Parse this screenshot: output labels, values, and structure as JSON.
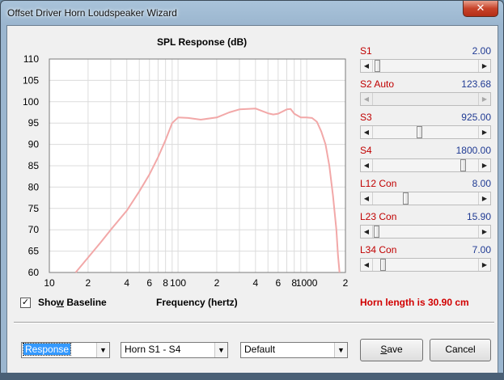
{
  "window": {
    "title": "Offset Driver Horn Loudspeaker Wizard",
    "close_label": "✕"
  },
  "chart": {
    "title": "SPL Response (dB)",
    "xlabel": "Frequency (hertz)"
  },
  "chart_data": {
    "type": "line",
    "title": "SPL Response (dB)",
    "xlabel": "Frequency (hertz)",
    "ylabel": "",
    "xscale": "log",
    "xlim": [
      10,
      2000
    ],
    "ylim": [
      60,
      110
    ],
    "grid": true,
    "y_ticks": [
      60,
      65,
      70,
      75,
      80,
      85,
      90,
      95,
      100,
      105,
      110
    ],
    "x_ticks": [
      {
        "v": 10,
        "label": "10"
      },
      {
        "v": 20,
        "label": "2"
      },
      {
        "v": 40,
        "label": "4"
      },
      {
        "v": 60,
        "label": "6"
      },
      {
        "v": 80,
        "label": "8"
      },
      {
        "v": 100,
        "label": "100"
      },
      {
        "v": 200,
        "label": "2"
      },
      {
        "v": 400,
        "label": "4"
      },
      {
        "v": 600,
        "label": "6"
      },
      {
        "v": 800,
        "label": "8"
      },
      {
        "v": 1000,
        "label": "1000"
      },
      {
        "v": 2000,
        "label": "2"
      }
    ],
    "series": [
      {
        "color": "#f2a8a8",
        "points": [
          [
            16,
            60
          ],
          [
            20,
            63.5
          ],
          [
            25,
            67
          ],
          [
            30,
            70
          ],
          [
            40,
            74.5
          ],
          [
            50,
            79
          ],
          [
            60,
            83
          ],
          [
            70,
            87
          ],
          [
            80,
            91
          ],
          [
            90,
            95
          ],
          [
            100,
            96.3
          ],
          [
            120,
            96.2
          ],
          [
            150,
            95.8
          ],
          [
            200,
            96.3
          ],
          [
            250,
            97.5
          ],
          [
            300,
            98.2
          ],
          [
            400,
            98.4
          ],
          [
            500,
            97.3
          ],
          [
            550,
            97
          ],
          [
            600,
            97.2
          ],
          [
            700,
            98.2
          ],
          [
            750,
            98.3
          ],
          [
            800,
            97.2
          ],
          [
            900,
            96.3
          ],
          [
            1000,
            96.3
          ],
          [
            1100,
            96.2
          ],
          [
            1200,
            95.3
          ],
          [
            1300,
            93
          ],
          [
            1400,
            90
          ],
          [
            1500,
            85
          ],
          [
            1600,
            78
          ],
          [
            1700,
            70
          ],
          [
            1750,
            64
          ],
          [
            1800,
            60
          ]
        ]
      }
    ]
  },
  "baseline": {
    "checked_glyph": "✓",
    "label_prefix": "Sho",
    "label_accel": "w",
    "label_suffix": " Baseline"
  },
  "horn_length": "Horn length is 30.90 cm",
  "params": [
    {
      "label": "S1",
      "value": "2.00",
      "thumb": 0.02,
      "disabled": false
    },
    {
      "label": "S2  Auto",
      "value": "123.68",
      "thumb": null,
      "disabled": true
    },
    {
      "label": "S3",
      "value": "925.00",
      "thumb": 0.44,
      "disabled": false
    },
    {
      "label": "S4",
      "value": "1800.00",
      "thumb": 0.88,
      "disabled": false
    },
    {
      "label": "L12  Con",
      "value": "8.00",
      "thumb": 0.3,
      "disabled": false
    },
    {
      "label": "L23  Con",
      "value": "15.90",
      "thumb": 0.01,
      "disabled": false
    },
    {
      "label": "L34  Con",
      "value": "7.00",
      "thumb": 0.07,
      "disabled": false
    }
  ],
  "combos": {
    "view": "Response",
    "horn": "Horn S1 - S4",
    "preset": "Default"
  },
  "buttons": {
    "save_accel": "S",
    "save_rest": "ave",
    "cancel": "Cancel"
  },
  "colors": {
    "accent_red": "#d10000",
    "value_blue": "#1f3a93",
    "curve": "#f2a8a8"
  },
  "icons": {
    "slider_left": "◀",
    "slider_right": "▶",
    "combo_arrow": "▼"
  }
}
